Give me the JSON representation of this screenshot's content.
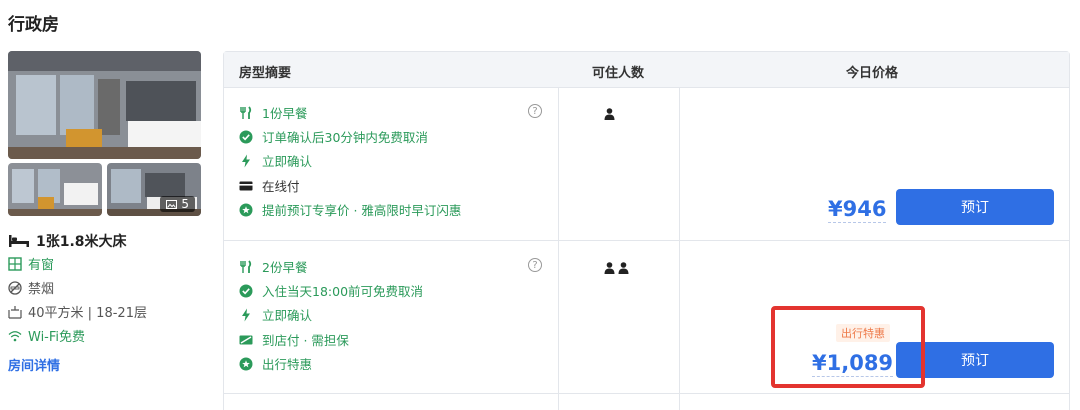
{
  "page": {
    "title": "行政房"
  },
  "room": {
    "photo_count": "5",
    "bed": "1张1.8米大床",
    "features": [
      {
        "icon": "window-icon",
        "label": "有窗",
        "color": "green"
      },
      {
        "icon": "no-smoking-icon",
        "label": "禁烟",
        "color": "gray"
      },
      {
        "icon": "area-icon",
        "label": "40平方米 | 18-21层",
        "color": "gray"
      },
      {
        "icon": "wifi-icon",
        "label": "Wi-Fi免费",
        "color": "green"
      }
    ],
    "details_link": "房间详情"
  },
  "table": {
    "headers": {
      "summary": "房型摘要",
      "guests": "可住人数",
      "price": "今日价格"
    },
    "rows": [
      {
        "policies": [
          {
            "icon": "fork-knife-icon",
            "text": "1份早餐",
            "color": "green"
          },
          {
            "icon": "check-circle-icon",
            "text": "订单确认后30分钟内免费取消",
            "color": "green"
          },
          {
            "icon": "lightning-icon",
            "text": "立即确认",
            "color": "green"
          },
          {
            "icon": "card-icon",
            "text": "在线付",
            "color": "dark"
          },
          {
            "icon": "star-badge-icon",
            "text": "提前预订专享价 · 雅高限时早订闪惠",
            "color": "green"
          }
        ],
        "guests": 1,
        "price": "¥946",
        "button": "预订"
      },
      {
        "policies": [
          {
            "icon": "fork-knife-icon",
            "text": "2份早餐",
            "color": "green"
          },
          {
            "icon": "check-circle-icon",
            "text": "入住当天18:00前可免费取消",
            "color": "green"
          },
          {
            "icon": "lightning-icon",
            "text": "立即确认",
            "color": "green"
          },
          {
            "icon": "pay-at-hotel-icon",
            "text": "到店付 · 需担保",
            "color": "green"
          },
          {
            "icon": "star-badge-icon",
            "text": "出行特惠",
            "color": "green"
          }
        ],
        "guests": 2,
        "tag": "出行特惠",
        "price": "¥1,089",
        "button": "预订"
      }
    ]
  },
  "colors": {
    "accent": "#2f6fe4",
    "green": "#2b9a5a",
    "highlight": "#e3342f",
    "tag": "#ee7a4a"
  }
}
